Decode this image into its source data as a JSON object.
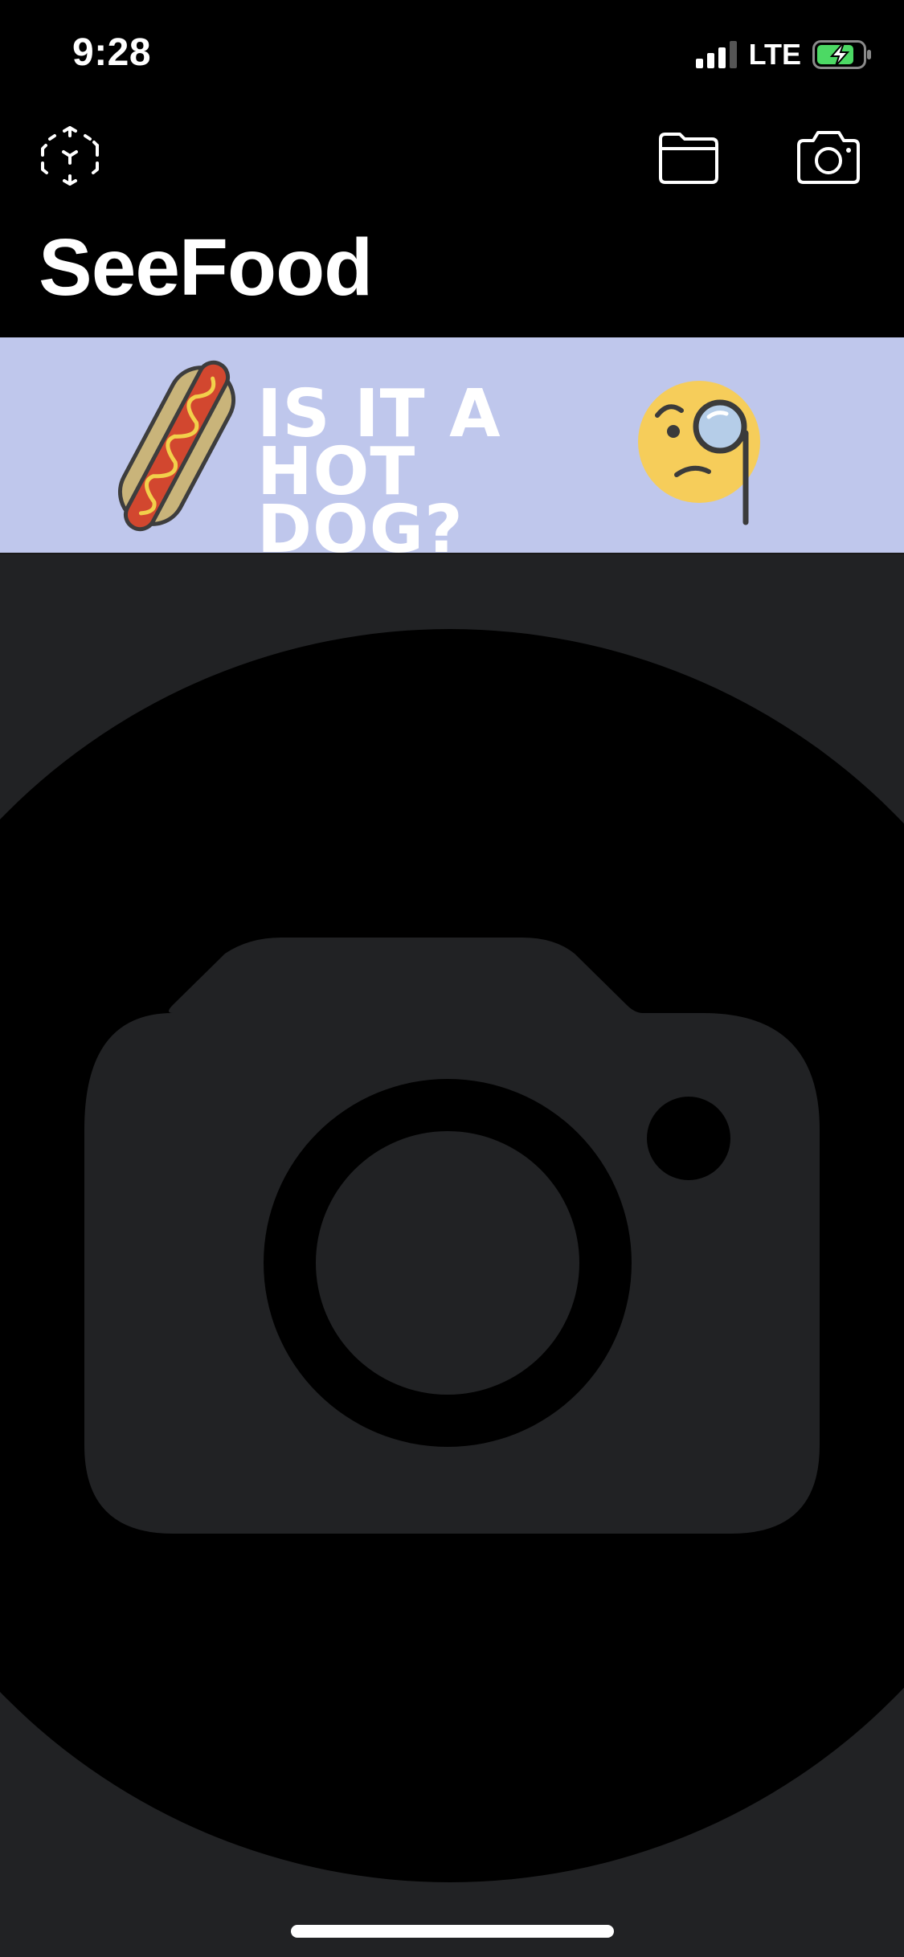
{
  "status_bar": {
    "time": "9:28",
    "network": "LTE",
    "signal_icon": "cellular-signal-icon",
    "battery_icon": "battery-charging-icon"
  },
  "nav": {
    "ar_icon": "ar-cube-icon",
    "folder_icon": "folder-icon",
    "camera_icon": "camera-icon",
    "title": "SeeFood"
  },
  "banner": {
    "text": "IS IT A HOT DOG?",
    "left_icon": "hot-dog-icon",
    "right_icon": "face-with-monocle-icon",
    "background": "#bfc7ec"
  },
  "photo_area": {
    "placeholder_icon": "camera-placeholder-icon",
    "background": "#212224"
  }
}
